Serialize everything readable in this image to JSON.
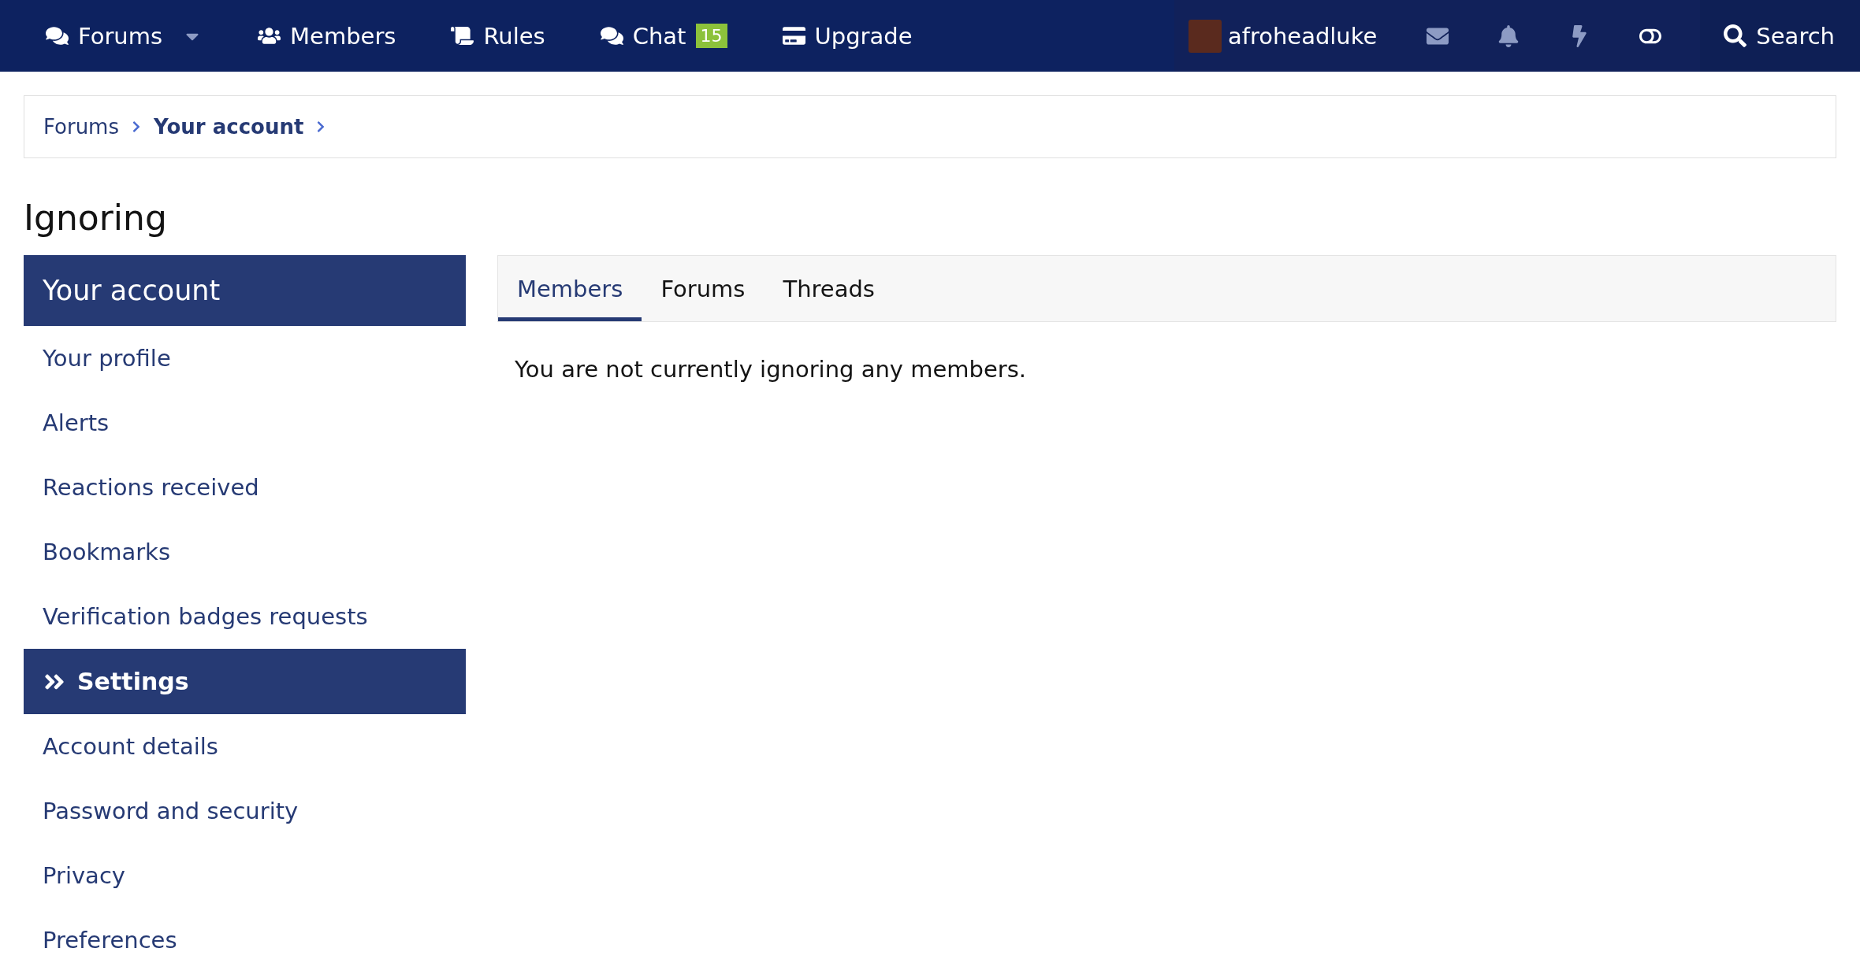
{
  "nav": {
    "items": [
      {
        "label": "Forums",
        "dropdown": true
      },
      {
        "label": "Members",
        "dropdown": false
      },
      {
        "label": "Rules",
        "dropdown": false
      },
      {
        "label": "Chat",
        "dropdown": false,
        "badge": "15"
      },
      {
        "label": "Upgrade",
        "dropdown": false
      }
    ],
    "user": {
      "name": "afroheadluke"
    },
    "search": {
      "label": "Search"
    }
  },
  "breadcrumb": [
    "Forums",
    "Your account"
  ],
  "page_title": "Ignoring",
  "sidebar": {
    "sections": [
      {
        "title": "Your account",
        "current": false,
        "items": [
          "Your profile",
          "Alerts",
          "Reactions received",
          "Bookmarks",
          "Verification badges requests"
        ]
      },
      {
        "title": "Settings",
        "current": true,
        "items": [
          "Account details",
          "Password and security",
          "Privacy",
          "Preferences"
        ]
      }
    ]
  },
  "tabs": [
    {
      "label": "Members",
      "selected": true
    },
    {
      "label": "Forums",
      "selected": false
    },
    {
      "label": "Threads",
      "selected": false
    }
  ],
  "message": "You are not currently ignoring any members."
}
